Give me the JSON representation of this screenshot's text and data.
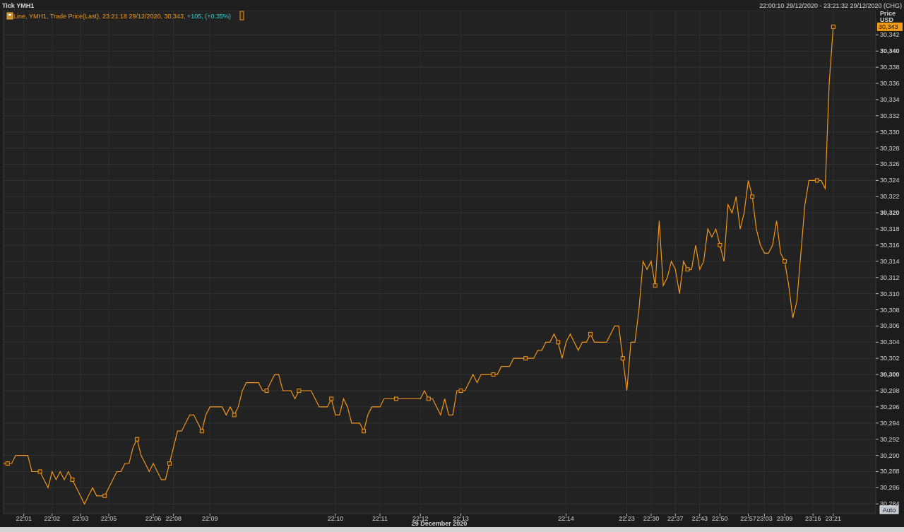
{
  "header": {
    "title": "Tick YMH1",
    "range": "22:00:10 29/12/2020 - 23:21:32 29/12/2020 (CHG)"
  },
  "legend": {
    "style": "Line,",
    "text": ", Trade Price(Last), 23:21:18 29/12/2020, 30,343, ",
    "change": "+105, (+0.35%)"
  },
  "axis": {
    "title": "Price",
    "unit": "USD",
    "last_price": "30,343",
    "date": "29 December 2020",
    "scale_button": "Auto"
  },
  "chart_data": {
    "type": "line",
    "grid": true,
    "categories": [
      null,
      null,
      null,
      null,
      null,
      "22:01",
      null,
      null,
      null,
      null,
      null,
      null,
      "22:02",
      null,
      null,
      null,
      null,
      null,
      null,
      "22:03",
      null,
      null,
      null,
      null,
      null,
      null,
      "22:05",
      null,
      null,
      null,
      null,
      null,
      null,
      null,
      null,
      null,
      null,
      "22:06",
      null,
      null,
      null,
      null,
      "22:08",
      null,
      null,
      null,
      null,
      null,
      null,
      null,
      null,
      "22:09",
      null,
      null,
      null,
      null,
      null,
      null,
      null,
      null,
      null,
      null,
      null,
      null,
      null,
      null,
      null,
      null,
      null,
      null,
      null,
      null,
      null,
      null,
      null,
      null,
      null,
      null,
      null,
      null,
      null,
      null,
      "22:10",
      null,
      null,
      null,
      null,
      null,
      null,
      null,
      null,
      null,
      null,
      "22:11",
      null,
      null,
      null,
      null,
      null,
      null,
      null,
      null,
      null,
      "22:12",
      null,
      null,
      null,
      null,
      null,
      null,
      null,
      null,
      null,
      "22:13",
      null,
      null,
      null,
      null,
      null,
      null,
      null,
      null,
      null,
      null,
      null,
      null,
      null,
      null,
      null,
      null,
      null,
      null,
      null,
      null,
      null,
      null,
      null,
      null,
      null,
      "22:14",
      null,
      null,
      null,
      null,
      null,
      null,
      null,
      null,
      null,
      null,
      null,
      null,
      null,
      null,
      "22:23",
      null,
      null,
      null,
      null,
      null,
      "22:30",
      null,
      null,
      null,
      null,
      null,
      "22:37",
      null,
      null,
      null,
      null,
      null,
      "22:43",
      null,
      null,
      null,
      null,
      "22:50",
      null,
      null,
      null,
      null,
      null,
      null,
      "22:57",
      null,
      null,
      null,
      "23:03",
      null,
      null,
      null,
      null,
      "23:09",
      null,
      null,
      null,
      null,
      null,
      null,
      "23:16",
      null,
      null,
      null,
      null,
      "23:21"
    ],
    "series": [
      {
        "name": "YMH1",
        "color": "#f0961e",
        "values": [
          30289,
          30289,
          30289,
          30290,
          30290,
          30290,
          30290,
          30288,
          30288,
          30288,
          30287,
          30286,
          30288,
          30287,
          30288,
          30287,
          30288,
          30287,
          30286,
          30285,
          30284,
          30285,
          30286,
          30285,
          30285,
          30285,
          30286,
          30287,
          30288,
          30288,
          30289,
          30289,
          30291,
          30292,
          30290,
          30289,
          30288,
          30289,
          30288,
          30287,
          30287,
          30289,
          30291,
          30293,
          30293,
          30294,
          30295,
          30295,
          30294,
          30293,
          30295,
          30296,
          30296,
          30296,
          30296,
          30295,
          30296,
          30295,
          30296,
          30298,
          30299,
          30299,
          30299,
          30299,
          30298,
          30298,
          30299,
          30300,
          30300,
          30298,
          30298,
          30298,
          30297,
          30298,
          30298,
          30298,
          30298,
          30297,
          30296,
          30296,
          30296,
          30297,
          30295,
          30295,
          30297,
          30296,
          30294,
          30294,
          30294,
          30293,
          30295,
          30296,
          30296,
          30296,
          30297,
          30297,
          30297,
          30297,
          30297,
          30297,
          30297,
          30297,
          30297,
          30297,
          30298,
          30297,
          30297,
          30296,
          30295,
          30297,
          30295,
          30295,
          30298,
          30298,
          30298,
          30299,
          30300,
          30299,
          30300,
          30300,
          30300,
          30300,
          30300,
          30301,
          30301,
          30301,
          30302,
          30302,
          30302,
          30302,
          30302,
          30302,
          30303,
          30303,
          30304,
          30304,
          30305,
          30304,
          30302,
          30304,
          30305,
          30304,
          30303,
          30304,
          30304,
          30305,
          30304,
          30304,
          30304,
          30304,
          30305,
          30306,
          30306,
          30302,
          30298,
          30304,
          30304,
          30308,
          30314,
          30313,
          30314,
          30311,
          30319,
          30311,
          30312,
          30314,
          30313,
          30310,
          30314,
          30313,
          30313,
          30316,
          30313,
          30314,
          30318,
          30317,
          30318,
          30316,
          30314,
          30321,
          30320,
          30322,
          30318,
          30320,
          30324,
          30322,
          30318,
          30316,
          30315,
          30315,
          30316,
          30319,
          30315,
          30314,
          30311,
          30307,
          30309,
          30315,
          30321,
          30324,
          30324,
          30324,
          30324,
          30323,
          30336,
          30343
        ]
      }
    ],
    "ylim": [
      30282.8,
      30345
    ],
    "yticks": [
      {
        "value": 30284,
        "label": "30,284"
      },
      {
        "value": 30286,
        "label": "30,286"
      },
      {
        "value": 30288,
        "label": "30,288"
      },
      {
        "value": 30290,
        "label": "30,290"
      },
      {
        "value": 30292,
        "label": "30,292"
      },
      {
        "value": 30294,
        "label": "30,294"
      },
      {
        "value": 30296,
        "label": "30,296"
      },
      {
        "value": 30298,
        "label": "30,298"
      },
      {
        "value": 30300,
        "label": "30,300"
      },
      {
        "value": 30302,
        "label": "30,302"
      },
      {
        "value": 30304,
        "label": "30,304"
      },
      {
        "value": 30306,
        "label": "30,306"
      },
      {
        "value": 30308,
        "label": "30,308"
      },
      {
        "value": 30310,
        "label": "30,310"
      },
      {
        "value": 30312,
        "label": "30,312"
      },
      {
        "value": 30314,
        "label": "30,314"
      },
      {
        "value": 30316,
        "label": "30,316"
      },
      {
        "value": 30318,
        "label": "30,318"
      },
      {
        "value": 30320,
        "label": "30,320"
      },
      {
        "value": 30322,
        "label": "30,322"
      },
      {
        "value": 30324,
        "label": "30,324"
      },
      {
        "value": 30326,
        "label": "30,326"
      },
      {
        "value": 30328,
        "label": "30,328"
      },
      {
        "value": 30330,
        "label": "30,330"
      },
      {
        "value": 30332,
        "label": "30,332"
      },
      {
        "value": 30334,
        "label": "30,334"
      },
      {
        "value": 30336,
        "label": "30,336"
      },
      {
        "value": 30338,
        "label": "30,338"
      },
      {
        "value": 30340,
        "label": "30,340"
      },
      {
        "value": 30342,
        "label": "30,342"
      }
    ]
  }
}
